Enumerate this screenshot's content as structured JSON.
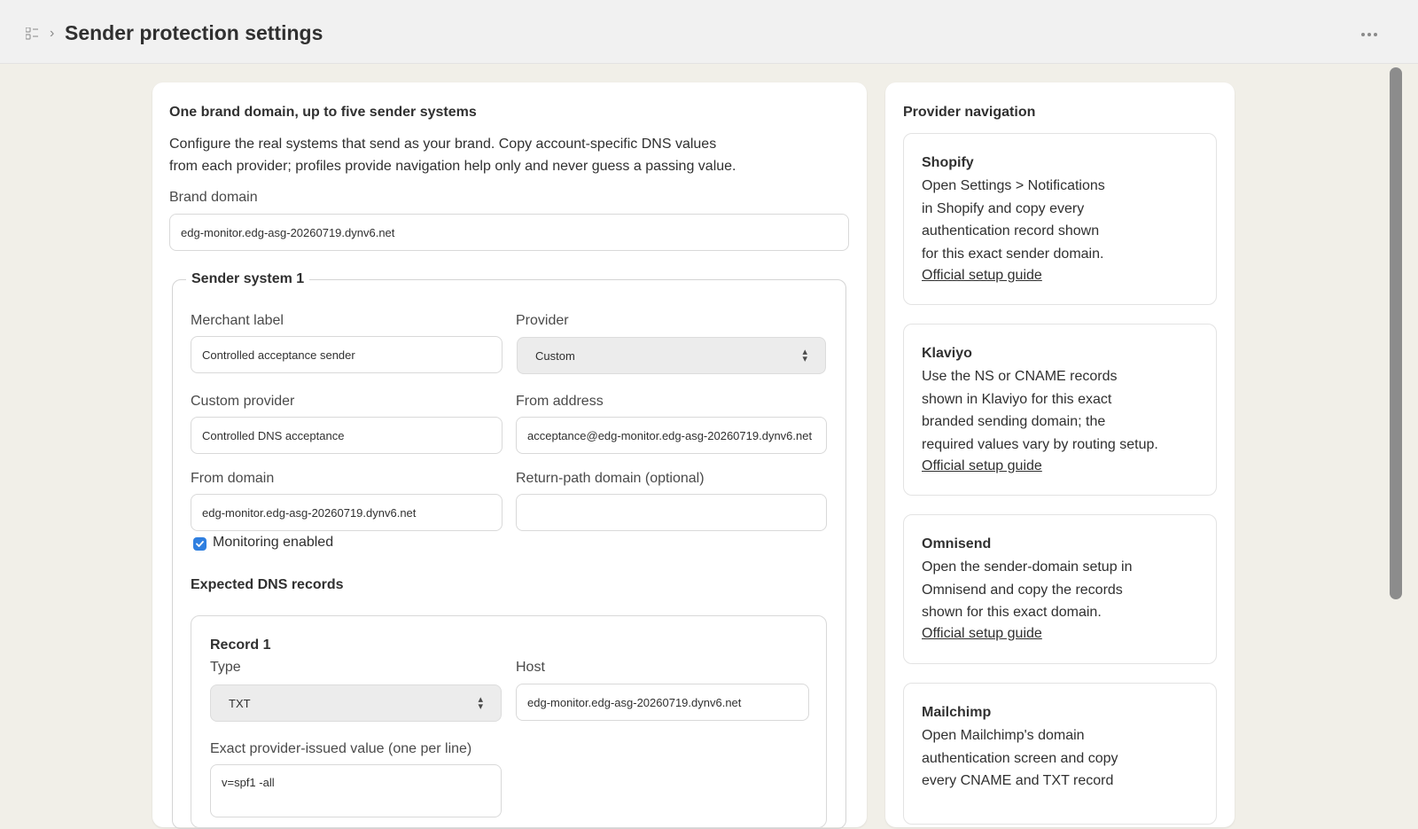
{
  "header": {
    "title": "Sender protection settings",
    "app_icon": "apps-icon",
    "breadcrumb_chevron": "›",
    "more_icon": "more-horizontal-icon"
  },
  "main": {
    "heading": "One brand domain, up to five sender systems",
    "description_line1": "Configure the real systems that send as your brand. Copy account-specific DNS values",
    "description_line2": "from each provider; profiles provide navigation help only and never guess a passing value.",
    "brand_domain_label": "Brand domain",
    "brand_domain_value": "edg-monitor.edg-asg-20260719.dynv6.net",
    "sender_system": {
      "legend": "Sender system 1",
      "merchant_label_label": "Merchant label",
      "merchant_label_value": "Controlled acceptance sender",
      "provider_label": "Provider",
      "provider_value": "Custom",
      "custom_provider_label": "Custom provider",
      "custom_provider_value": "Controlled DNS acceptance",
      "from_address_label": "From address",
      "from_address_value": "acceptance@edg-monitor.edg-asg-20260719.dynv6.net",
      "from_domain_label": "From domain",
      "from_domain_value": "edg-monitor.edg-asg-20260719.dynv6.net",
      "return_path_label": "Return-path domain (optional)",
      "return_path_value": "",
      "monitoring_label": "Monitoring enabled",
      "monitoring_checked": true,
      "expected_dns_heading": "Expected DNS records",
      "record": {
        "title": "Record 1",
        "type_label": "Type",
        "type_value": "TXT",
        "host_label": "Host",
        "host_value": "edg-monitor.edg-asg-20260719.dynv6.net",
        "value_label": "Exact provider-issued value (one per line)",
        "value_value": "v=spf1 -all"
      }
    }
  },
  "sidebar": {
    "heading": "Provider navigation",
    "providers": [
      {
        "name": "Shopify",
        "lines": [
          "Open Settings > Notifications",
          "in Shopify and copy every",
          "authentication record shown",
          "for this exact sender domain."
        ],
        "link": "Official setup guide"
      },
      {
        "name": "Klaviyo",
        "lines": [
          "Use the NS or CNAME records",
          "shown in Klaviyo for this exact",
          "branded sending domain; the",
          "required values vary by routing setup."
        ],
        "link": "Official setup guide"
      },
      {
        "name": "Omnisend",
        "lines": [
          "Open the sender-domain setup in",
          "Omnisend and copy the records",
          "shown for this exact domain."
        ],
        "link": "Official setup guide"
      },
      {
        "name": "Mailchimp",
        "lines": [
          "Open Mailchimp's domain",
          "authentication screen and copy",
          "every CNAME and TXT record"
        ],
        "link": ""
      }
    ]
  },
  "colors": {
    "page_background": "#f1efe8",
    "topbar_background": "#f1f1f1",
    "checkbox_accent": "#2f7fe0"
  }
}
